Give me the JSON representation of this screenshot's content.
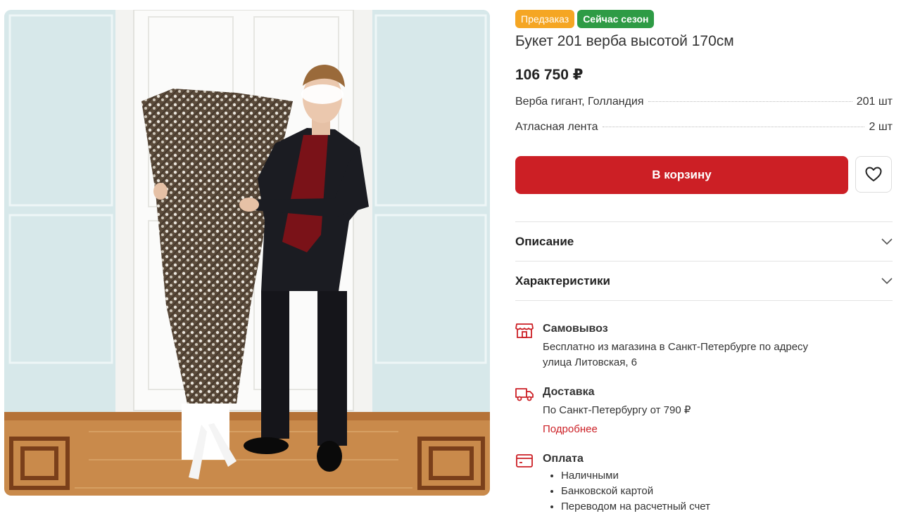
{
  "product": {
    "badges": [
      "Предзаказ",
      "Сейчас сезон"
    ],
    "title": "Букет 201 верба высотой 170см",
    "price": "106 750 ₽",
    "composition": [
      {
        "name": "Верба гигант, Голландия",
        "qty": "201 шт"
      },
      {
        "name": "Атласная лента",
        "qty": "2 шт"
      }
    ]
  },
  "actions": {
    "cart_label": "В корзину",
    "favorite_icon": "heart-icon"
  },
  "accordion": [
    "Описание",
    "Характеристики"
  ],
  "services": {
    "pickup": {
      "icon": "store-icon",
      "title": "Самовывоз",
      "line1": "Бесплатно из магазина в Санкт-Петербурге по адресу",
      "line2": "улица Литовская, 6"
    },
    "delivery": {
      "icon": "truck-icon",
      "title": "Доставка",
      "text": "По Санкт-Петербургу от 790 ₽",
      "more": "Подробнее"
    },
    "payment": {
      "icon": "wallet-icon",
      "title": "Оплата",
      "methods": [
        "Наличными",
        "Банковской картой",
        "Переводом на расчетный счет"
      ]
    }
  },
  "colors": {
    "accent": "#cc1f25",
    "badge_preorder": "#f5a623",
    "badge_season": "#2e9b45"
  }
}
